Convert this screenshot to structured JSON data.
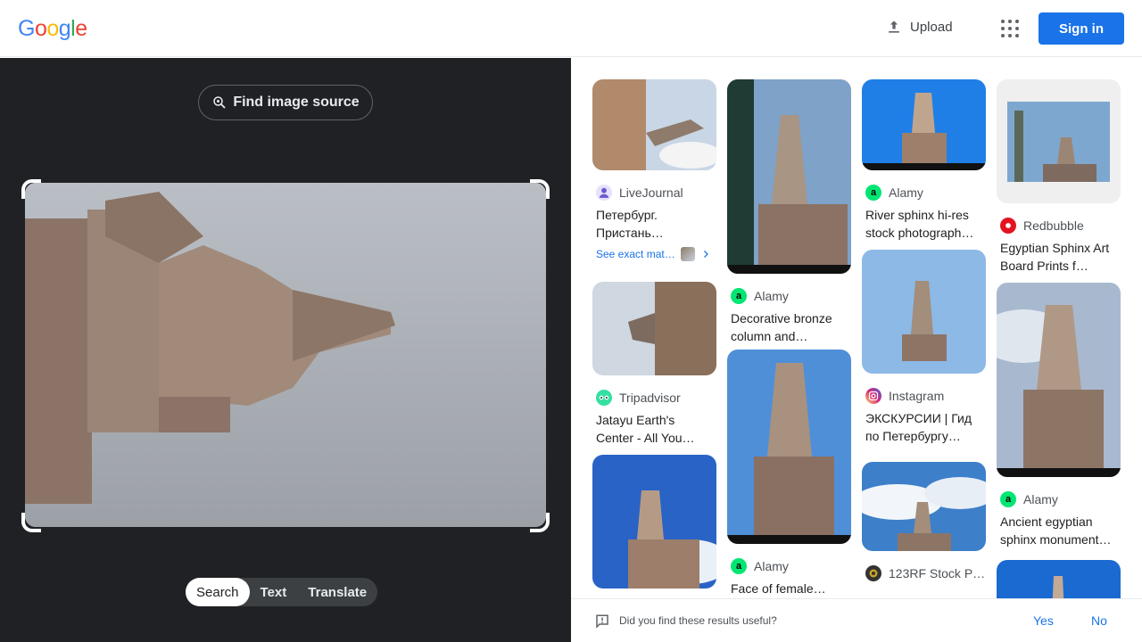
{
  "header": {
    "logo": [
      "G",
      "o",
      "o",
      "g",
      "l",
      "e"
    ],
    "logo_colors": [
      "#4285f4",
      "#ea4335",
      "#fbbc05",
      "#4285f4",
      "#34a853",
      "#ea4335"
    ],
    "upload_label": "Upload",
    "signin_label": "Sign in"
  },
  "left": {
    "find_source_label": "Find image source",
    "modes": [
      "Search",
      "Text",
      "Translate"
    ],
    "active_mode": "Search"
  },
  "results": {
    "col1": [
      {
        "source": "LiveJournal",
        "title": "Петербург. Пристань…",
        "exact": "See exact mat…",
        "icon": "user-icon",
        "color": "#6a5acd"
      },
      {
        "source": "Tripadvisor",
        "title": "Jatayu Earth's Center - All You…",
        "icon": "owl-icon",
        "color": "#34e0a1"
      },
      {
        "source": "",
        "title": ""
      }
    ],
    "col2": [
      {
        "source": "Alamy",
        "title": "Decorative bronze column and…",
        "icon": "alamy-icon",
        "color": "#00e673"
      },
      {
        "source": "Alamy",
        "title": "Face of female…",
        "icon": "alamy-icon",
        "color": "#00e673"
      }
    ],
    "col3": [
      {
        "source": "Alamy",
        "title": "River sphinx hi-res stock photograph…",
        "icon": "alamy-icon",
        "color": "#00e673"
      },
      {
        "source": "Instagram",
        "title": "ЭКСКУРСИИ | Гид по Петербургу…",
        "icon": "instagram-icon",
        "color": "#d62976"
      },
      {
        "source": "123RF Stock P…",
        "title": "",
        "icon": "123rf-icon",
        "color": "#333333"
      }
    ],
    "col4": [
      {
        "source": "Redbubble",
        "title": "Egyptian Sphinx Art Board Prints f…",
        "icon": "redbubble-icon",
        "color": "#e41321"
      },
      {
        "source": "Alamy",
        "title": "Ancient egyptian sphinx monument…",
        "icon": "alamy-icon",
        "color": "#00e673"
      }
    ]
  },
  "feedback": {
    "question": "Did you find these results useful?",
    "yes": "Yes",
    "no": "No"
  }
}
